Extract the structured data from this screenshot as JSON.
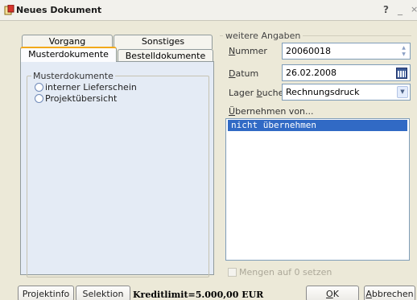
{
  "window": {
    "title": "Neues Dokument",
    "help_glyph": "?",
    "minimize_glyph": "_",
    "close_glyph": "×"
  },
  "tabs": [
    {
      "label": "Vorgang",
      "active": false
    },
    {
      "label": "Sonstiges",
      "active": false
    },
    {
      "label": "Musterdokumente",
      "active": true
    },
    {
      "label": "Bestelldokumente",
      "active": false
    }
  ],
  "musterdokumente": {
    "group_label": "Musterdokumente",
    "options": [
      {
        "label": "interner Lieferschein",
        "selected": false
      },
      {
        "label": "Projektübersicht",
        "selected": false
      }
    ]
  },
  "weitere_angaben": {
    "legend": "weitere Angaben",
    "nummer": {
      "label_u": "N",
      "label_rest": "ummer",
      "value": "20060018"
    },
    "datum": {
      "label_u": "D",
      "label_rest": "atum",
      "value": "26.02.2008"
    },
    "lager": {
      "label_pre": "Lager ",
      "label_u": "b",
      "label_rest": "uchen",
      "value": "Rechnungsdruck"
    },
    "uebernehmen": {
      "label_u": "Ü",
      "label_rest": "bernehmen von...",
      "items": [
        "nicht übernehmen"
      ]
    },
    "mengen_checkbox": {
      "label": "Mengen auf 0 setzen",
      "checked": false,
      "enabled": false
    }
  },
  "footer": {
    "projektinfo": "Projektinfo",
    "selektion": "Selektion",
    "kreditlimit": "Kreditlimit=5.000,00 EUR",
    "ok_u": "O",
    "ok_rest": "K",
    "abbrechen_u": "A",
    "abbrechen_rest": "bbrechen"
  },
  "colors": {
    "tab_accent": "#f2a91a",
    "selection": "#316ac5",
    "panel_bg": "#e4ebf5",
    "dialog_bg": "#ece9d8"
  }
}
